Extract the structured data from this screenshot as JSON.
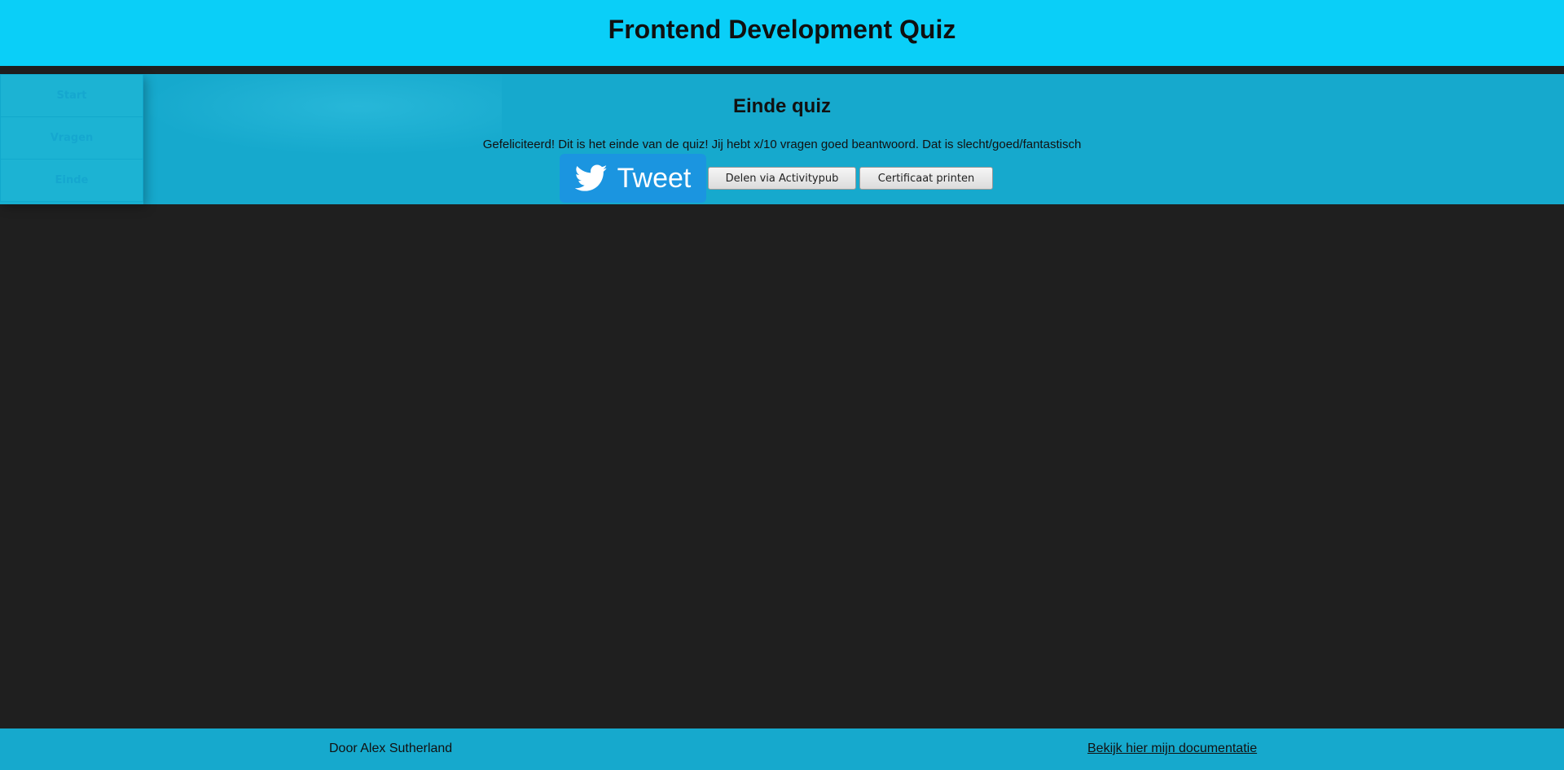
{
  "header": {
    "title": "Frontend Development Quiz"
  },
  "sidebar": {
    "items": [
      {
        "label": "Start"
      },
      {
        "label": "Vragen"
      },
      {
        "label": "Einde"
      }
    ]
  },
  "main": {
    "title": "Einde quiz",
    "message": "Gefeliciteerd! Dit is het einde van de quiz! Jij hebt x/10 vragen goed beantwoord. Dat is slecht/goed/fantastisch",
    "actions": {
      "tweet_label": "Tweet",
      "activitypub_label": "Delen via Activitypub",
      "certificate_label": "Certificaat printen"
    }
  },
  "footer": {
    "author": "Door Alex Sutherland",
    "docs_link": "Bekijk hier mijn documentatie"
  },
  "colors": {
    "header_bg": "#0acff8",
    "panel_bg": "#16a9cd",
    "page_bg": "#1f1f1f",
    "tweet_bg": "#1b95e0"
  },
  "icons": {
    "tweet": "twitter-bird-icon"
  }
}
